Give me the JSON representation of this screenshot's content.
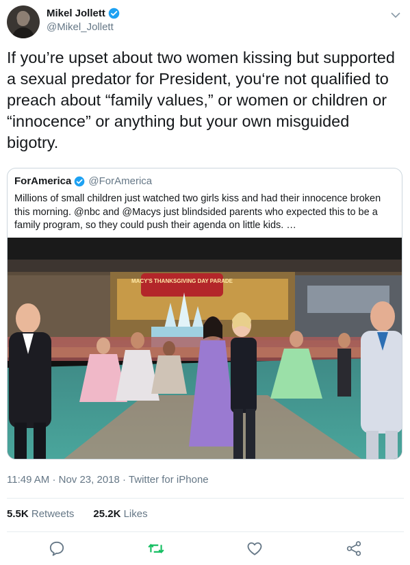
{
  "author": {
    "name": "Mikel Jollett",
    "handle": "@Mikel_Jollett"
  },
  "tweet": {
    "text": "If you’re upset about two women kissing but supported a sexual predator for President, you‘re not qualified to preach about “family values,” or women or children or “innocence” or anything but your own misguided bigotry."
  },
  "quoted": {
    "name": "ForAmerica",
    "handle": "@ForAmerica",
    "text": "Millions of small children just watched two girls kiss and had their innocence broken this morning. @nbc and @Macys just blindsided parents who expected this to be a family program, so they could push their agenda on little kids. …",
    "media_sign": "MACY'S THANKSGIVING DAY PARADE"
  },
  "meta": {
    "time": "11:49 AM",
    "date": "Nov 23, 2018",
    "source": "Twitter for iPhone",
    "sep": "·"
  },
  "stats": {
    "retweets_count": "5.5K",
    "retweets_label": "Retweets",
    "likes_count": "25.2K",
    "likes_label": "Likes"
  },
  "icons": {
    "verified": "verified-badge-icon",
    "chevron": "chevron-down-icon",
    "reply": "reply-icon",
    "retweet": "retweet-icon",
    "like": "like-icon",
    "share": "share-icon"
  },
  "colors": {
    "accent": "#1da1f2",
    "retweet": "#17bf63",
    "secondary": "#657786",
    "border": "#ccd6dd"
  }
}
